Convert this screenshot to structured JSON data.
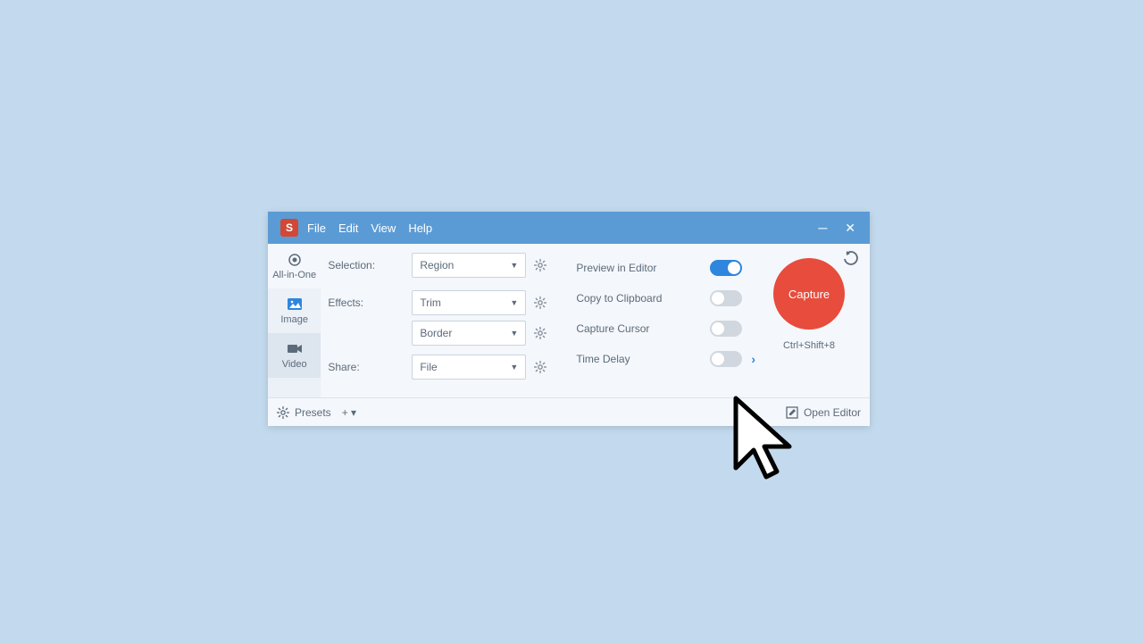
{
  "menubar": {
    "file": "File",
    "edit": "Edit",
    "view": "View",
    "help": "Help"
  },
  "tabs": {
    "allinone": "All-in-One",
    "image": "Image",
    "video": "Video"
  },
  "labels": {
    "selection": "Selection:",
    "effects": "Effects:",
    "share": "Share:"
  },
  "selects": {
    "region": "Region",
    "trim": "Trim",
    "border": "Border",
    "file": "File"
  },
  "options": {
    "preview": "Preview in Editor",
    "clipboard": "Copy to Clipboard",
    "cursor": "Capture Cursor",
    "delay": "Time Delay"
  },
  "capture": {
    "label": "Capture",
    "hotkey": "Ctrl+Shift+8"
  },
  "footer": {
    "presets": "Presets",
    "openeditor": "Open Editor"
  },
  "appicon": "S"
}
